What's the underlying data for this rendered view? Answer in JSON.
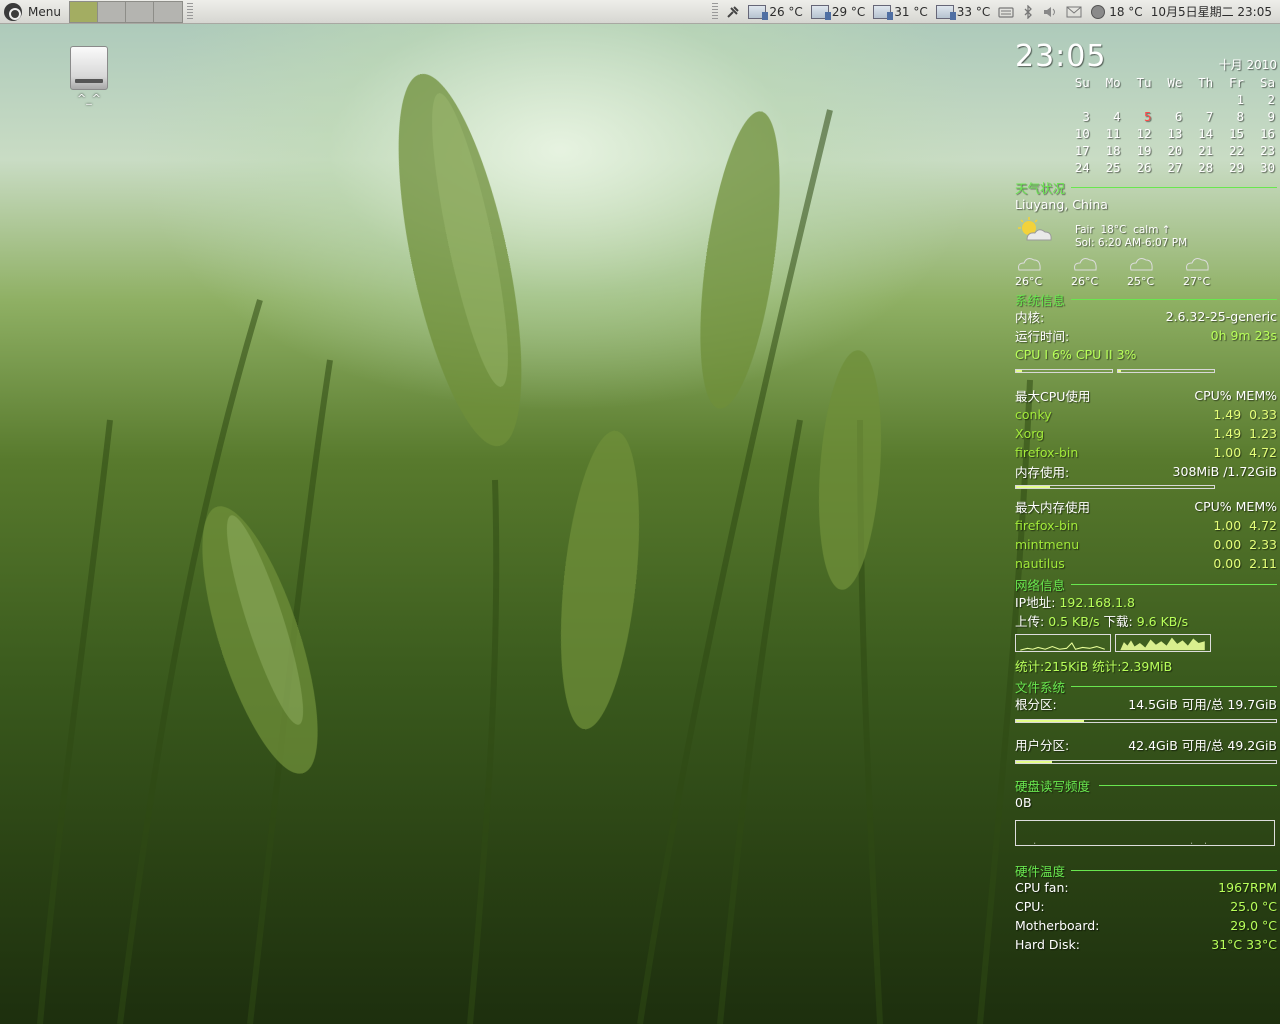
{
  "panel": {
    "menu_label": "Menu",
    "temps": [
      "26 °C",
      "29 °C",
      "31 °C",
      "33 °C"
    ],
    "weather_temp": "18 °C",
    "datetime": "10月5日星期二 23:05"
  },
  "desktop": {
    "drive_label": "^_^"
  },
  "conky": {
    "time": "23:05",
    "month": "十月 2010",
    "calendar": {
      "weekdays": [
        "Su",
        "Mo",
        "Tu",
        "We",
        "Th",
        "Fr",
        "Sa"
      ],
      "weeks": [
        [
          "",
          "",
          "",
          "",
          "",
          "1",
          "2"
        ],
        [
          "3",
          "4",
          "5",
          "6",
          "7",
          "8",
          "9"
        ],
        [
          "10",
          "11",
          "12",
          "13",
          "14",
          "15",
          "16"
        ],
        [
          "17",
          "18",
          "19",
          "20",
          "21",
          "22",
          "23"
        ],
        [
          "24",
          "25",
          "26",
          "27",
          "28",
          "29",
          "30"
        ]
      ],
      "today": "5"
    },
    "weather": {
      "title": "天气状况",
      "location": "Liuyang, China",
      "condition": "Fair",
      "temp": "18°C",
      "wind": "calm",
      "sun": "Sol: 6:20 AM-6:07 PM",
      "forecast": [
        "26°C",
        "26°C",
        "25°C",
        "27°C"
      ]
    },
    "sysinfo": {
      "title": "系统信息",
      "kernel_label": "内核:",
      "kernel": "2.6.32-25-generic",
      "uptime_label": "运行时间:",
      "uptime": "0h 9m 23s",
      "cpu_text": "CPU I 6% CPU II 3%",
      "cpu1_pct": 6,
      "cpu2_pct": 3,
      "top_cpu_title": "最大CPU使用",
      "col_header": "CPU% MEM%",
      "top_cpu": [
        {
          "name": "conky",
          "cpu": "1.49",
          "mem": "0.33"
        },
        {
          "name": "Xorg",
          "cpu": "1.49",
          "mem": "1.23"
        },
        {
          "name": "firefox-bin",
          "cpu": "1.00",
          "mem": "4.72"
        }
      ],
      "mem_label": "内存使用:",
      "mem_value": "308MiB /1.72GiB",
      "mem_pct": 17,
      "top_mem_title": "最大内存使用",
      "top_mem": [
        {
          "name": "firefox-bin",
          "cpu": "1.00",
          "mem": "4.72"
        },
        {
          "name": "mintmenu",
          "cpu": "0.00",
          "mem": "2.33"
        },
        {
          "name": "nautilus",
          "cpu": "0.00",
          "mem": "2.11"
        }
      ]
    },
    "network": {
      "title": "网络信息",
      "ip_label": "IP地址:",
      "ip": "192.168.1.8",
      "up_label": "上传:",
      "up": "0.5 KB/s",
      "down_label": "下载:",
      "down": "9.6 KB/s",
      "total": "统计:215KiB 统计:2.39MiB"
    },
    "filesystem": {
      "title": "文件系统",
      "root_label": "根分区:",
      "root_value": "14.5GiB 可用/总 19.7GiB",
      "root_used_pct": 26,
      "home_label": "用户分区:",
      "home_value": "42.4GiB 可用/总 49.2GiB",
      "home_used_pct": 14
    },
    "disk_io": {
      "title": "硬盘读写频度",
      "value": "0B"
    },
    "hardware": {
      "title": "硬件温度",
      "fan_label": "CPU fan:",
      "fan": "1967RPM",
      "cpu_label": "CPU:",
      "cpu": "25.0 °C",
      "mb_label": "Motherboard:",
      "mb": "29.0 °C",
      "hdd_label": "Hard Disk:",
      "hdd": "31°C  33°C"
    }
  }
}
